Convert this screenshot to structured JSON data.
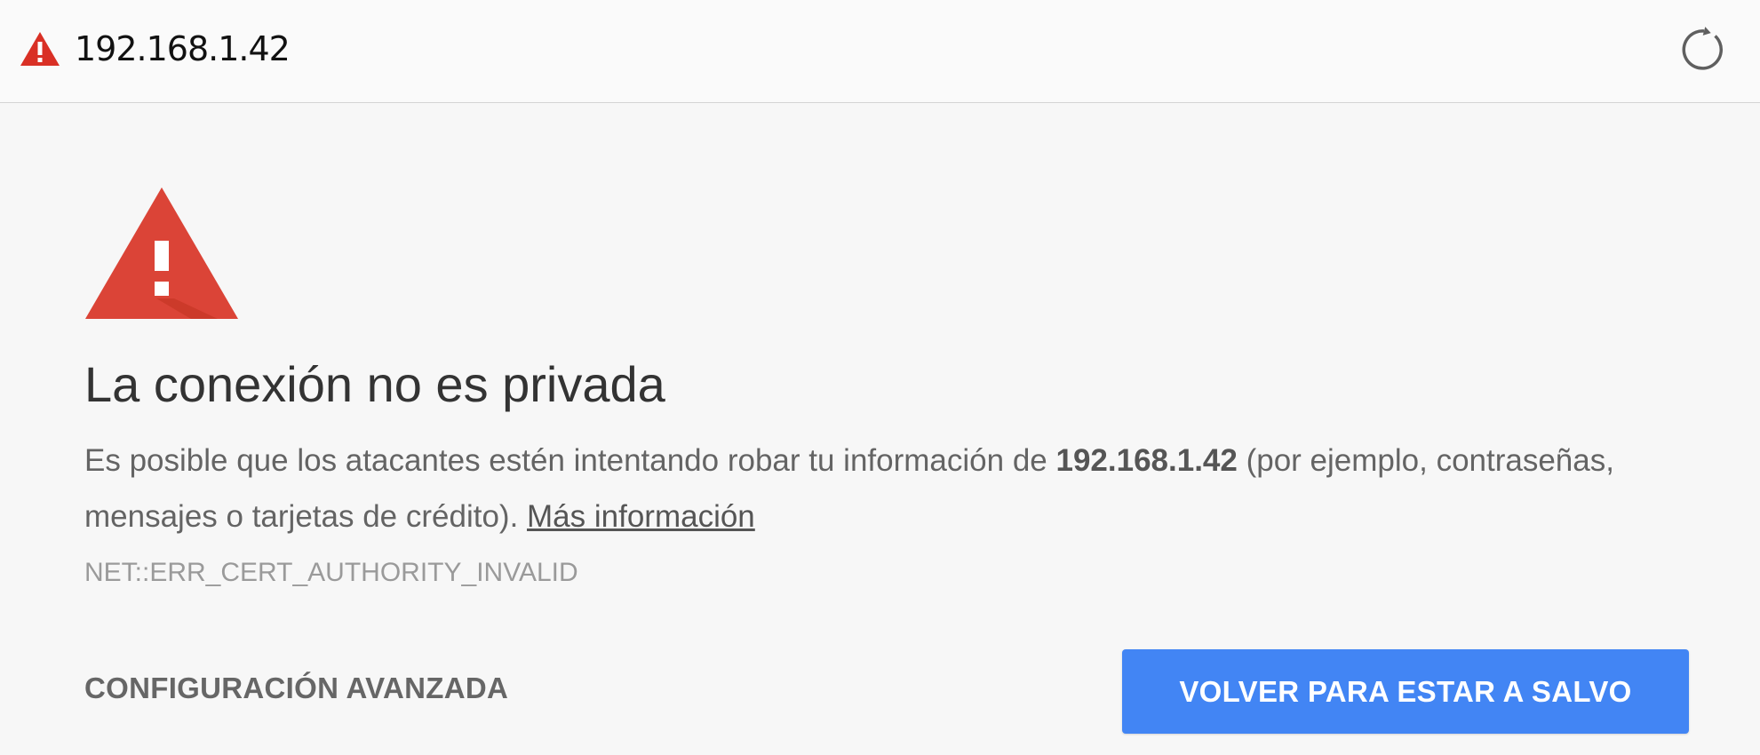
{
  "address_bar": {
    "url": "192.168.1.42",
    "warning_icon": "warning-triangle-icon",
    "warning_color": "#d93025",
    "reload_icon": "reload-icon"
  },
  "interstitial": {
    "icon": "warning-triangle-icon",
    "icon_color": "#db4437",
    "title": "La conexión no es privada",
    "body_prefix": "Es posible que los atacantes estén intentando robar tu información de ",
    "host": "192.168.1.42",
    "body_suffix": " (por ejemplo, contraseñas, mensajes o tarjetas de crédito). ",
    "more_info_link": "Más información",
    "error_code": "NET::ERR_CERT_AUTHORITY_INVALID",
    "advanced_label": "CONFIGURACIÓN AVANZADA",
    "back_label": "VOLVER PARA ESTAR A SALVO",
    "accent_color": "#4285f4"
  }
}
